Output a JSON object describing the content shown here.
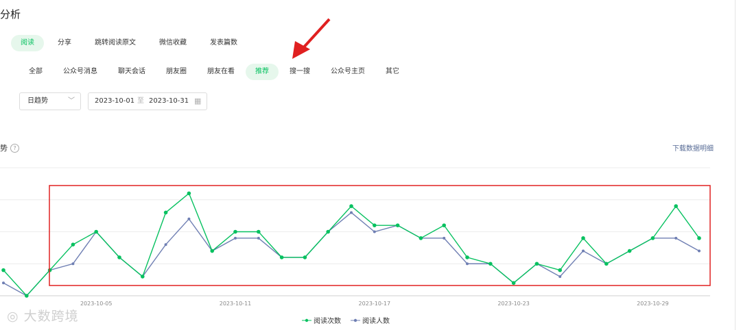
{
  "page": {
    "title": "分析"
  },
  "metric_tabs": [
    {
      "label": "阅读",
      "active": true
    },
    {
      "label": "分享",
      "active": false
    },
    {
      "label": "跳转阅读原文",
      "active": false
    },
    {
      "label": "微信收藏",
      "active": false
    },
    {
      "label": "发表篇数",
      "active": false
    }
  ],
  "source_tabs": [
    {
      "label": "全部",
      "active": false
    },
    {
      "label": "公众号消息",
      "active": false
    },
    {
      "label": "聊天会话",
      "active": false
    },
    {
      "label": "朋友圈",
      "active": false
    },
    {
      "label": "朋友在看",
      "active": false
    },
    {
      "label": "推荐",
      "active": true
    },
    {
      "label": "搜一搜",
      "active": false
    },
    {
      "label": "公众号主页",
      "active": false
    },
    {
      "label": "其它",
      "active": false
    }
  ],
  "filters": {
    "granularity": "日趋势",
    "date_start": "2023-10-01",
    "date_sep": "至",
    "date_end": "2023-10-31"
  },
  "trend": {
    "title_suffix": "势",
    "help_glyph": "?",
    "download_label": "下载数据明细"
  },
  "watermark": "大数跨境",
  "colors": {
    "read_count": "#07c160",
    "read_users": "#6f7fb3",
    "highlight_box": "#e02020",
    "annotation_arrow": "#e02020",
    "active_chip_bg": "#e6f7ec"
  },
  "chart_data": {
    "type": "line",
    "x": [
      "2023-10-01",
      "2023-10-02",
      "2023-10-03",
      "2023-10-04",
      "2023-10-05",
      "2023-10-06",
      "2023-10-07",
      "2023-10-08",
      "2023-10-09",
      "2023-10-10",
      "2023-10-11",
      "2023-10-12",
      "2023-10-13",
      "2023-10-14",
      "2023-10-15",
      "2023-10-16",
      "2023-10-17",
      "2023-10-18",
      "2023-10-19",
      "2023-10-20",
      "2023-10-21",
      "2023-10-22",
      "2023-10-23",
      "2023-10-24",
      "2023-10-25",
      "2023-10-26",
      "2023-10-27",
      "2023-10-28",
      "2023-10-29",
      "2023-10-30",
      "2023-10-31"
    ],
    "x_tick_labels": [
      "2023-10-05",
      "2023-10-11",
      "2023-10-17",
      "2023-10-23",
      "2023-10-29"
    ],
    "series": [
      {
        "name": "阅读次数",
        "values": [
          4,
          0,
          4,
          8,
          10,
          6,
          3,
          13,
          16,
          7,
          10,
          10,
          6,
          6,
          10,
          14,
          11,
          11,
          9,
          11,
          6,
          5,
          2,
          5,
          4,
          9,
          5,
          7,
          9,
          14,
          9
        ]
      },
      {
        "name": "阅读人数",
        "values": [
          2,
          0,
          4,
          5,
          10,
          6,
          3,
          8,
          12,
          7,
          9,
          9,
          6,
          6,
          10,
          13,
          10,
          11,
          9,
          9,
          5,
          5,
          2,
          5,
          3,
          7,
          5,
          7,
          9,
          9,
          7
        ]
      }
    ],
    "ylim": [
      0,
      20
    ],
    "grid": true,
    "legend_position": "bottom-center"
  }
}
